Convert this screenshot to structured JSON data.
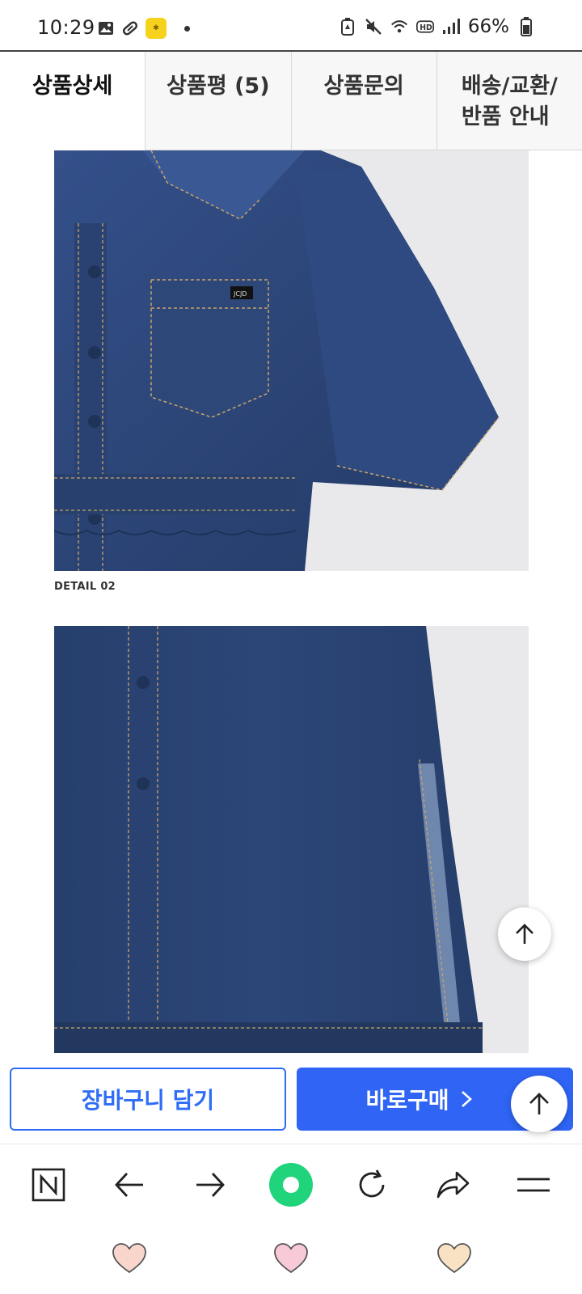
{
  "status_bar": {
    "time": "10:29",
    "battery": "66%",
    "icons_left": [
      "gallery-icon",
      "pill-icon",
      "app-badge-icon"
    ],
    "icons_right": [
      "battery-saver-icon",
      "mute-icon",
      "wifi-icon",
      "hd-icon",
      "signal-icon",
      "battery-icon"
    ]
  },
  "tabs": [
    {
      "label": "상품상세",
      "active": true
    },
    {
      "label": "상품평 (5)",
      "active": false
    },
    {
      "label": "상품문의",
      "active": false
    },
    {
      "label": "배송/교환/\n반품 안내",
      "active": false
    }
  ],
  "content": {
    "detail_label": "DETAIL 02",
    "pocket_tag": "JCJD"
  },
  "actions": {
    "cart_label": "장바구니 담기",
    "buy_label": "바로구매"
  },
  "browser_toolbar": {
    "items": [
      "naver-home-icon",
      "back-arrow-icon",
      "forward-arrow-icon",
      "green-dot-icon",
      "refresh-icon",
      "share-icon",
      "menu-icon"
    ]
  },
  "colors": {
    "accent_blue": "#2f64f5",
    "denim": "#2b4373",
    "green": "#1fd47a"
  }
}
